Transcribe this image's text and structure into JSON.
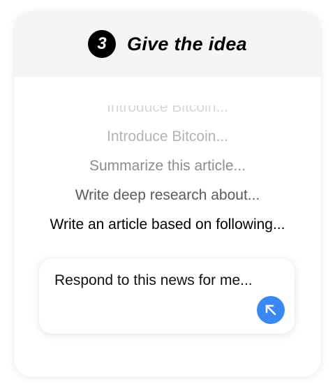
{
  "header": {
    "step_number": "3",
    "title": "Give the idea",
    "background": "#f5f5f5"
  },
  "prompts": [
    {
      "text": "Introduce Bitcoin..."
    },
    {
      "text": "Introduce Bitcoin..."
    },
    {
      "text": "Summarize this article..."
    },
    {
      "text": "Write deep research about..."
    },
    {
      "text": "Write an article based on following..."
    }
  ],
  "input": {
    "value": "Respond to this news for me...",
    "send_icon": "arrow-up-left-icon",
    "send_color": "#3b87f0"
  }
}
